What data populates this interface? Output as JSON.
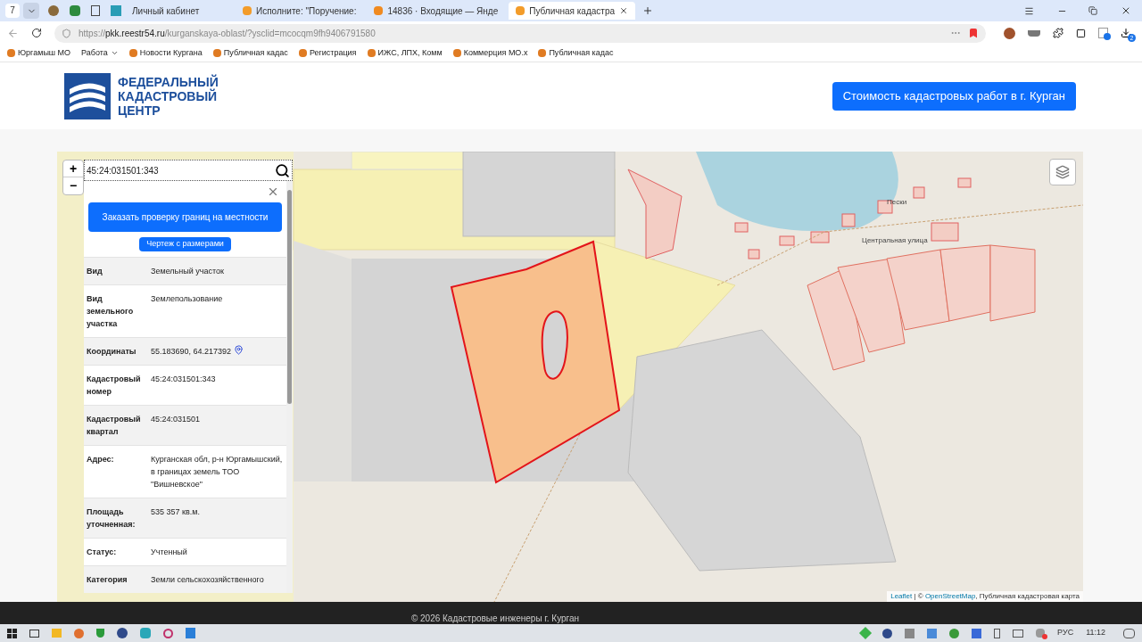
{
  "browser": {
    "tab_count": "7",
    "tabs": [
      {
        "title": "Личный кабинет",
        "selected": false
      },
      {
        "title": "Исполните: \"Поручение:",
        "selected": false
      },
      {
        "title": "14836 · Входящие — Янде",
        "selected": false
      },
      {
        "title": "Публичная кадастра",
        "selected": true
      }
    ],
    "url_scheme": "https://",
    "url_host": "pkk.reestr54.ru",
    "url_path": "/kurganskaya-oblast/?ysclid=mcocqm9fh9406791580",
    "bookmarks": [
      {
        "title": "Юргамыш МО",
        "kind": "plain"
      },
      {
        "title": "Работа",
        "kind": "folder"
      },
      {
        "title": "Новости Кургана",
        "kind": "plain"
      },
      {
        "title": "Публичная кадас",
        "kind": "plain"
      },
      {
        "title": "Регистрация",
        "kind": "plain"
      },
      {
        "title": "ИЖС, ЛПХ, Комм",
        "kind": "plain"
      },
      {
        "title": "Коммерция МО.х",
        "kind": "plain"
      },
      {
        "title": "Публичная кадас",
        "kind": "plain"
      }
    ],
    "downloads_badge": "2"
  },
  "site": {
    "logo_lines": [
      "ФЕДЕРАЛЬНЫЙ",
      "КАДАСТРОВЫЙ",
      "ЦЕНТР"
    ],
    "cta": "Стоимость кадастровых работ в г. Курган"
  },
  "map": {
    "zoom_in": "+",
    "zoom_out": "−",
    "search_value": "45:24:031501:343",
    "labels": [
      "Пески",
      "Центральная улица"
    ],
    "attribution": {
      "leaflet": "Leaflet",
      "sep": " | © ",
      "osm": "OpenStreetMap",
      "rest": ", Публичная кадастровая карта"
    }
  },
  "panel": {
    "order_button": "Заказать проверку границ на местности",
    "drawing_button": "Чертеж с размерами",
    "rows": [
      {
        "label": "Вид",
        "value": "Земельный участок",
        "kind": "text"
      },
      {
        "label": "Вид земельного участка",
        "value": "Землепользование",
        "kind": "text"
      },
      {
        "label": "Координаты",
        "value": "55.183690, 64.217392",
        "kind": "coords"
      },
      {
        "label": "Кадастровый номер",
        "value": "45:24:031501:343",
        "kind": "text"
      },
      {
        "label": "Кадастровый квартал",
        "value": "45:24:031501",
        "kind": "text"
      },
      {
        "label": "Адрес:",
        "value": "Курганская обл, р-н Юргамышский, в границах земель ТОО \"Вишневское\"",
        "kind": "text"
      },
      {
        "label": "Площадь уточненная:",
        "value": "535 357 кв.м.",
        "kind": "text"
      },
      {
        "label": "Статус:",
        "value": "Учтенный",
        "kind": "text"
      },
      {
        "label": "Категория",
        "value": "Земли сельскохозяйственного",
        "kind": "text"
      }
    ]
  },
  "footer": "© 2026 Кадастровые инженеры г. Курган",
  "taskbar": {
    "language": "РУС",
    "time": "11:12"
  }
}
